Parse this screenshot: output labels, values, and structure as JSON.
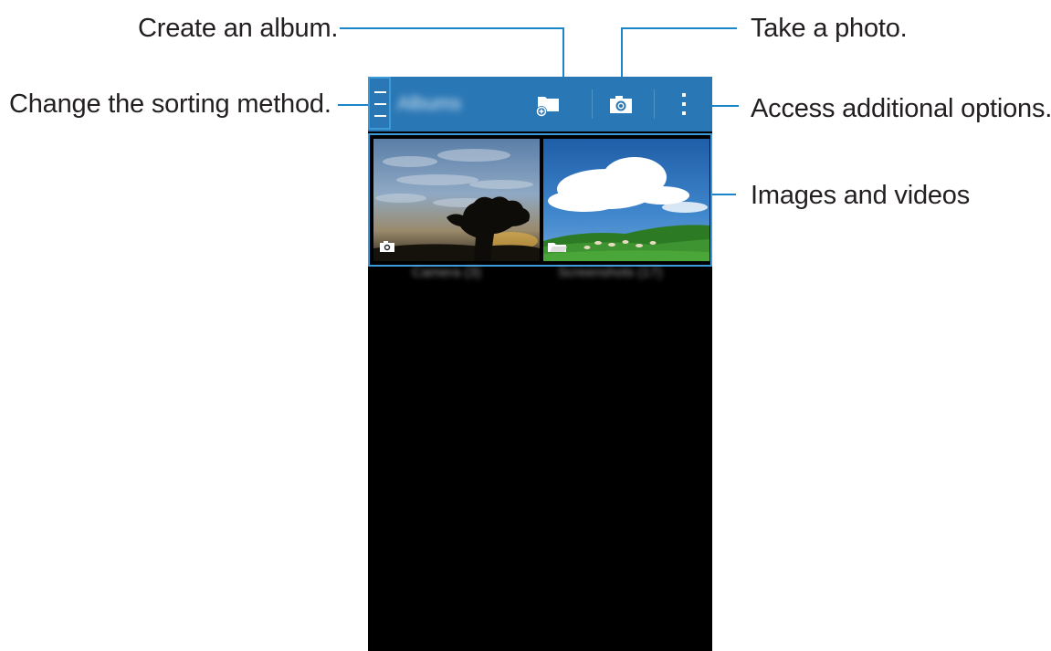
{
  "callouts": {
    "create_album": "Create an album.",
    "take_photo": "Take a photo.",
    "change_sorting": "Change the sorting method.",
    "additional_options": "Access additional options.",
    "images_videos": "Images and videos"
  },
  "action_bar": {
    "title": "Albums",
    "color": "#2a77b5"
  },
  "albums": [
    {
      "label": "Camera (3)",
      "type_icon": "camera-icon"
    },
    {
      "label": "Screenshots (17)",
      "type_icon": "folder-icon"
    }
  ],
  "colors": {
    "callout_line": "#1a86c8",
    "highlight_border": "#3c9ad8",
    "screen_background": "#000000"
  }
}
